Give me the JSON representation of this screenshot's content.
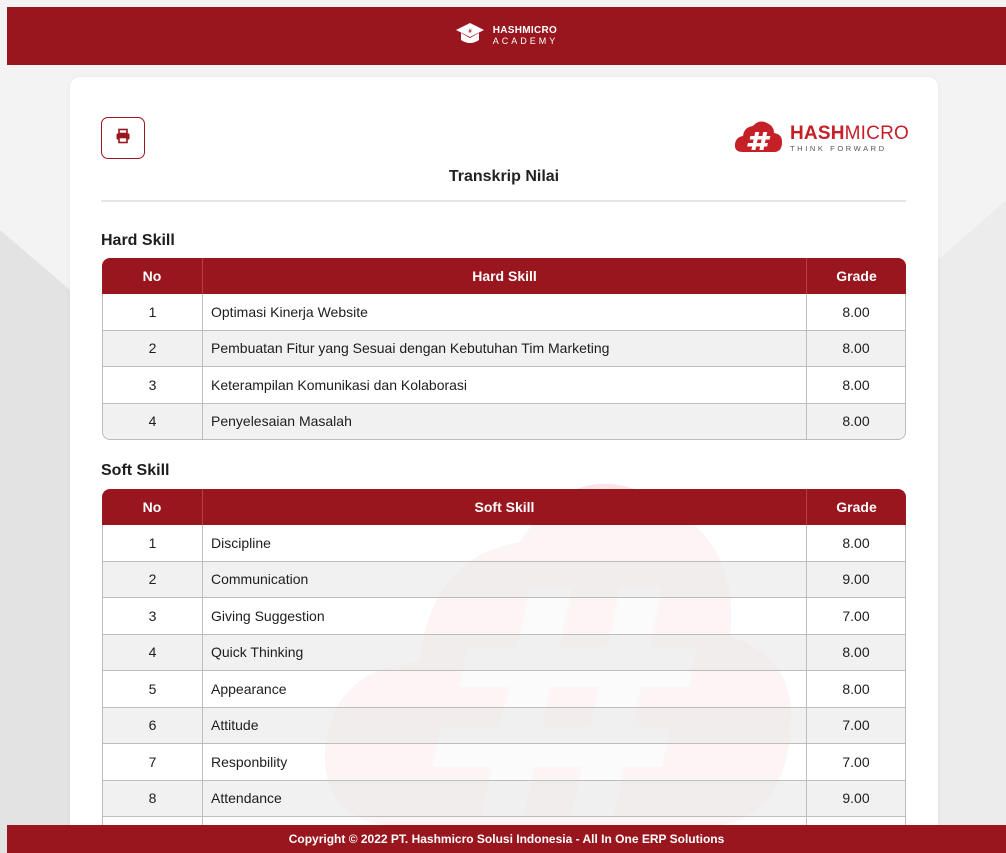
{
  "header": {
    "logo_line1": "HASHMICRO",
    "logo_line2": "ACADEMY",
    "logo_icon": "academy-cap-icon"
  },
  "card": {
    "print_icon": "printer-icon",
    "brand": {
      "name_bold": "HASH",
      "name_light": "MICRO",
      "tagline": "THINK FORWARD",
      "icon": "hashmicro-cloud-icon"
    },
    "title": "Transkrip Nilai"
  },
  "hard_skill": {
    "section_title": "Hard Skill",
    "columns": [
      "No",
      "Hard Skill",
      "Grade"
    ],
    "rows": [
      {
        "no": "1",
        "skill": "Optimasi Kinerja Website",
        "grade": "8.00"
      },
      {
        "no": "2",
        "skill": "Pembuatan Fitur yang Sesuai dengan Kebutuhan Tim Marketing",
        "grade": "8.00"
      },
      {
        "no": "3",
        "skill": "Keterampilan Komunikasi dan Kolaborasi",
        "grade": "8.00"
      },
      {
        "no": "4",
        "skill": "Penyelesaian Masalah",
        "grade": "8.00"
      }
    ]
  },
  "soft_skill": {
    "section_title": "Soft Skill",
    "columns": [
      "No",
      "Soft Skill",
      "Grade"
    ],
    "rows": [
      {
        "no": "1",
        "skill": "Discipline",
        "grade": "8.00"
      },
      {
        "no": "2",
        "skill": "Communication",
        "grade": "9.00"
      },
      {
        "no": "3",
        "skill": "Giving Suggestion",
        "grade": "7.00"
      },
      {
        "no": "4",
        "skill": "Quick Thinking",
        "grade": "8.00"
      },
      {
        "no": "5",
        "skill": "Appearance",
        "grade": "8.00"
      },
      {
        "no": "6",
        "skill": "Attitude",
        "grade": "7.00"
      },
      {
        "no": "7",
        "skill": "Responbility",
        "grade": "7.00"
      },
      {
        "no": "8",
        "skill": "Attendance",
        "grade": "9.00"
      },
      {
        "no": "",
        "skill": "",
        "grade": ""
      }
    ]
  },
  "footer": {
    "copyright": "Copyright © 2022 PT. Hashmicro Solusi Indonesia - All In One ERP Solutions"
  },
  "colors": {
    "brand_red": "#9a161e",
    "logo_red": "#c51f27",
    "page_bg": "#f3f3f3"
  }
}
